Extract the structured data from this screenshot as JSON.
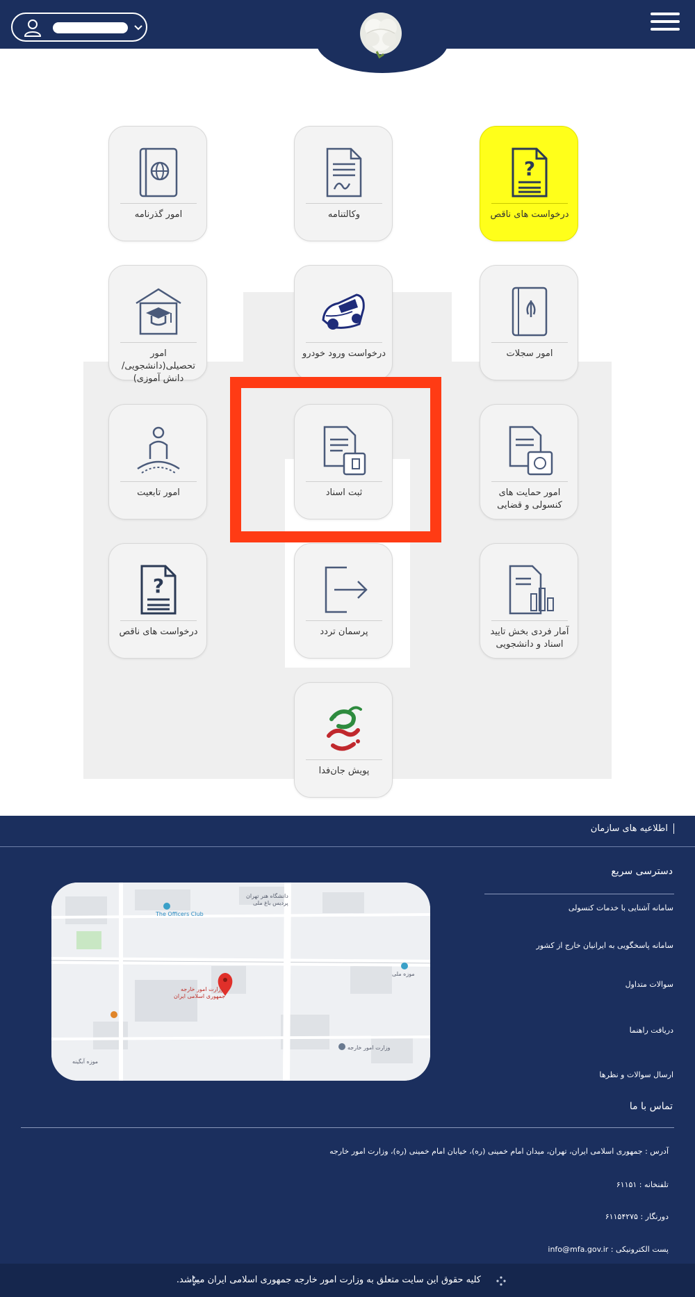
{
  "header": {
    "logo": "white-flower-logo",
    "menu_icon": "hamburger-icon",
    "user_icon": "user-icon"
  },
  "tiles": [
    {
      "label": "درخواست های ناقص",
      "icon": "document-question-icon",
      "highlight": true
    },
    {
      "label": "وکالتنامه",
      "icon": "document-signature-icon"
    },
    {
      "label": "امور گذرنامه",
      "icon": "passport-icon"
    },
    {
      "label": "امور سجلات",
      "icon": "iran-passport-icon"
    },
    {
      "label": "درخواست ورود خودرو",
      "icon": "car-icon"
    },
    {
      "label": "امور تحصیلی(دانشجویی/ دانش آموزی)",
      "icon": "graduation-cap-icon"
    },
    {
      "label": "امور حمایت های کنسولی و قضایی",
      "icon": "document-emblem-icon"
    },
    {
      "label": "ثبت اسناد",
      "icon": "document-stamp-icon"
    },
    {
      "label": "امور تابعیت",
      "icon": "person-globe-icon"
    },
    {
      "label": "آمار فردی بخش تایید اسناد و دانشجویی",
      "icon": "document-chart-icon"
    },
    {
      "label": "پرسمان تردد",
      "icon": "exit-arrow-icon"
    },
    {
      "label": "درخواست های ناقص",
      "icon": "document-question-icon"
    },
    {
      "label": "پویش جان‌فدا",
      "icon": "janfada-calligraphy-icon"
    }
  ],
  "footer": {
    "announcements": "اطلاعیه های سازمان",
    "quick_access_title": "دسترسی سریع",
    "quick_links": [
      "سامانه آشنایی با خدمات کنسولی",
      "سامانه پاسخگویی به ایرانیان خارج از کشور",
      "سوالات متداول",
      "دریافت راهنما",
      "ارسال سوالات و نظرها"
    ],
    "contact_title": "تماس با ما",
    "address": "آدرس : جمهوری اسلامی ایران، تهران، میدان امام خمینی (ره)، خیابان امام خمینی (ره)، وزارت امور خارجه",
    "phone": "تلفنخانه : ۶۱۱۵۱",
    "fax": "دورنگار : ۶۱۱۵۴۲۷۵",
    "email": "پست الکترونیکی : info@mfa.gov.ir",
    "copyright": "کلیه حقوق این سایت متعلق به وزارت امور خارجه جمهوری اسلامی ایران میباشد.",
    "map": {
      "labels": [
        "دانشگاه هنر تهران",
        "پردیس باغ ملی",
        "The Officers Club",
        "وزارت امور خارجه",
        "جمهوری اسلامی ایران",
        "موزه ملی",
        "موزه آبگینه",
        "وزارت امور خارجه"
      ]
    }
  }
}
